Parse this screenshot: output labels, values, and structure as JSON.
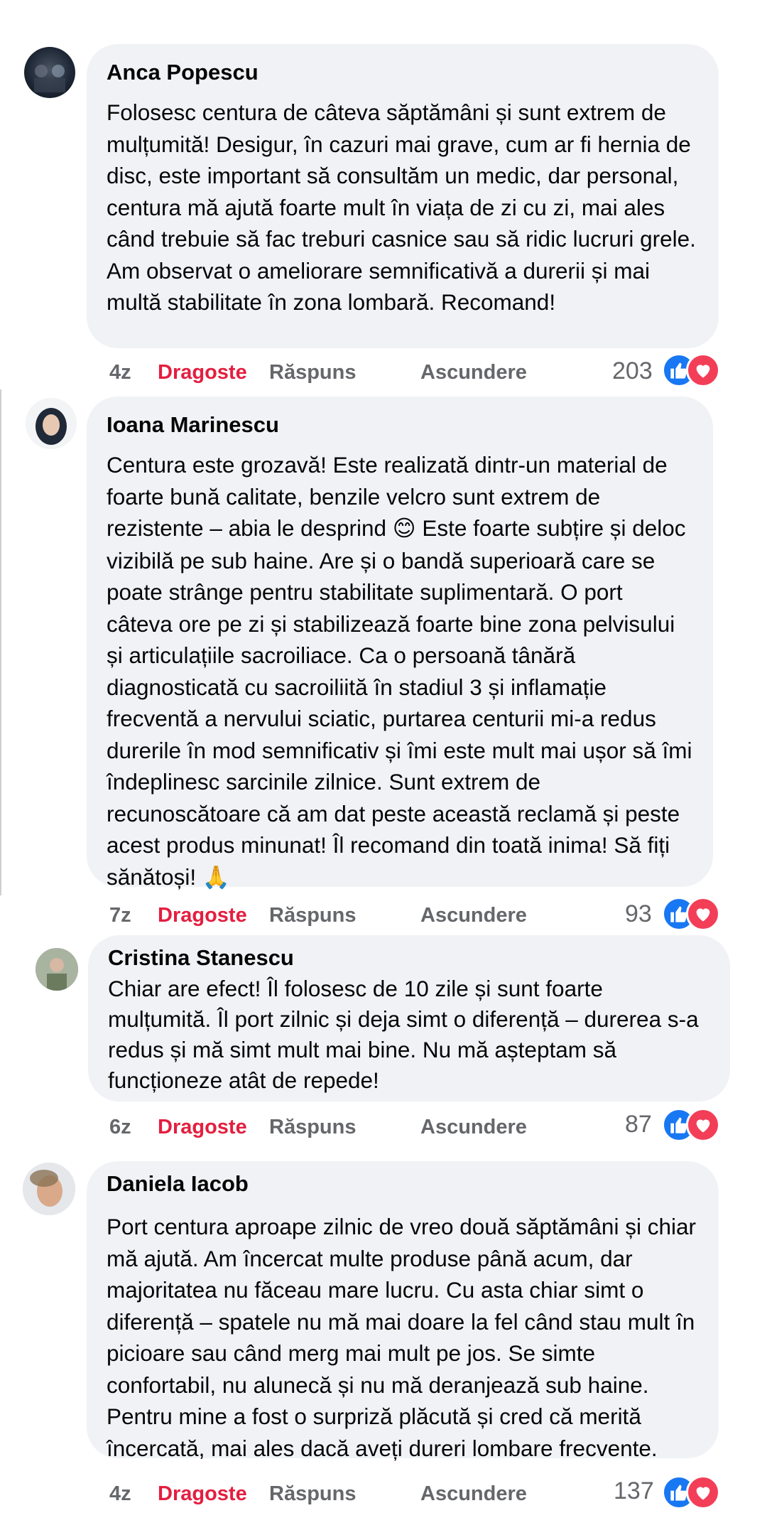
{
  "comments": [
    {
      "author": "Anca Popescu",
      "text": "Folosesc centura de câteva săptămâni și sunt extrem de mulțumită! Desigur, în cazuri mai grave, cum ar fi hernia de disc, este important să consultăm un medic, dar personal, centura mă ajută foarte mult în viața de zi cu zi, mai ales când trebuie să fac treburi casnice sau să ridic lucruri grele. Am observat o ameliorare semnificativă a durerii și mai multă stabilitate în zona lombară. Recomand!",
      "time": "4z",
      "love_label": "Dragoste",
      "reply_label": "Răspuns",
      "hide_label": "Ascundere",
      "reaction_count": "203"
    },
    {
      "author": "Ioana Marinescu",
      "text_1": "Centura este grozavă! Este realizată dintr-un material de foarte bună calitate, benzile velcro sunt extrem de rezistente – abia le desprind ",
      "emoji_1": "😊",
      "text_2": " Este foarte subțire și deloc vizibilă pe sub haine. Are și o bandă superioară care se poate strânge pentru stabilitate suplimentară. O port câteva ore pe zi și stabilizează foarte bine zona pelvisului și articulațiile sacroiliace. Ca o persoană tânără diagnosticată cu sacroiliită în stadiul 3 și inflamație frecventă a nervului sciatic, purtarea centurii mi-a redus durerile în mod semnificativ și îmi este mult mai ușor să îmi îndeplinesc sarcinile zilnice. Sunt extrem de recunoscătoare că am dat peste această reclamă și peste acest produs minunat! Îl recomand din toată inima! Să fiți sănătoși! ",
      "emoji_2": "🙏",
      "time": "7z",
      "love_label": "Dragoste",
      "reply_label": "Răspuns",
      "hide_label": "Ascundere",
      "reaction_count": "93"
    },
    {
      "author": "Cristina Stanescu",
      "text": "Chiar are efect! Îl folosesc de 10 zile și sunt foarte mulțumită. Îl port zilnic și deja simt o diferență – durerea s-a redus și mă simt mult mai bine. Nu mă așteptam să funcționeze atât de repede!",
      "time": "6z",
      "love_label": "Dragoste",
      "reply_label": "Răspuns",
      "hide_label": "Ascundere",
      "reaction_count": "87"
    },
    {
      "author": "Daniela Iacob",
      "text": "Port centura aproape zilnic de vreo două săptămâni și chiar mă ajută. Am încercat multe produse până acum, dar majoritatea nu făceau mare lucru. Cu asta chiar simt o diferență – spatele nu mă mai doare la fel când stau mult în picioare sau când merg mai mult pe jos. Se simte confortabil, nu alunecă și nu mă deranjează sub haine. Pentru mine a fost o surpriză plăcută și cred că merită încercată, mai ales dacă aveți dureri lombare frecvente.",
      "time": "4z",
      "love_label": "Dragoste",
      "reply_label": "Răspuns",
      "hide_label": "Ascundere",
      "reaction_count": "137"
    }
  ],
  "colors": {
    "bubble": "#f0f2f5",
    "love_red": "#e41e3f",
    "like_blue": "#1877f2",
    "heart_pink": "#f33e58",
    "meta_gray": "#65676b"
  },
  "icons": {
    "like": "thumbs-up-icon",
    "love": "heart-icon"
  }
}
